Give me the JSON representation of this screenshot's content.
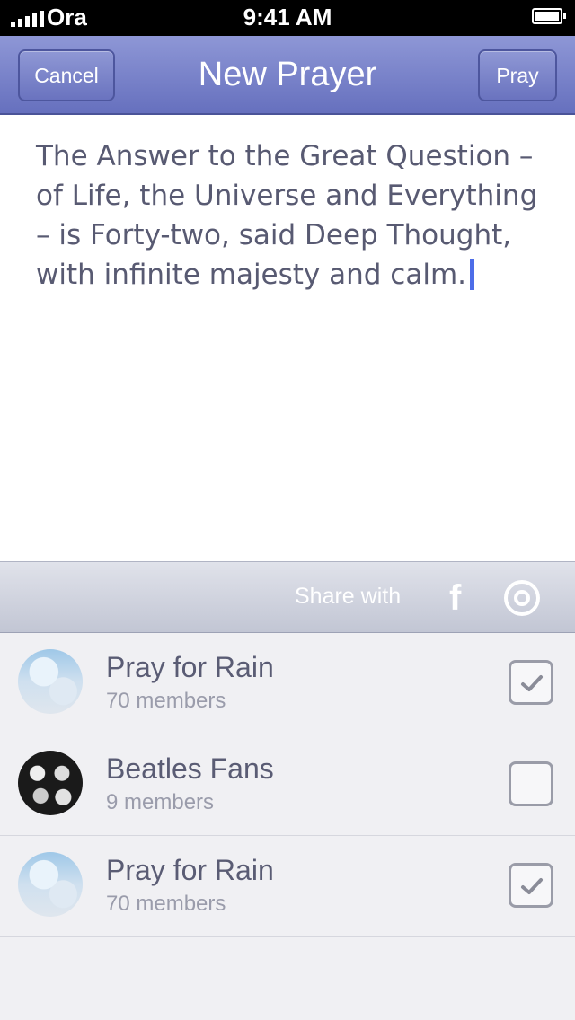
{
  "status_bar": {
    "carrier": "Ora",
    "time": "9:41 AM"
  },
  "nav": {
    "cancel_label": "Cancel",
    "title": "New Prayer",
    "pray_label": "Pray"
  },
  "editor": {
    "text": "The Answer to the Great Question – of Life, the Universe and Everything – is Forty-two, said Deep Thought, with infinite majesty and calm."
  },
  "share": {
    "label": "Share with",
    "icons": [
      "facebook-icon",
      "circle-target-icon"
    ]
  },
  "groups": [
    {
      "name": "Pray for Rain",
      "members": "70 members",
      "checked": true,
      "avatar": "clouds"
    },
    {
      "name": "Beatles Fans",
      "members": "9 members",
      "checked": false,
      "avatar": "beatles"
    },
    {
      "name": "Pray for Rain",
      "members": "70 members",
      "checked": true,
      "avatar": "clouds"
    }
  ],
  "colors": {
    "nav_bar": "#7880c8",
    "caret": "#4d6de8",
    "text": "#585a72"
  }
}
